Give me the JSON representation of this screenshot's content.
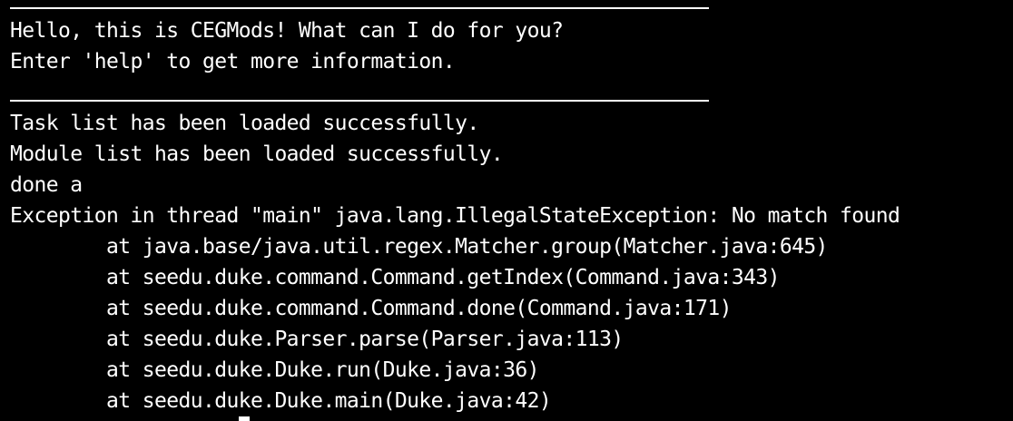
{
  "terminal": {
    "welcome": "Hello, this is CEGMods! What can I do for you?",
    "help_hint": "Enter 'help' to get more information.",
    "task_loaded": "Task list has been loaded successfully.",
    "module_loaded": "Module list has been loaded successfully.",
    "command": "done a",
    "exception": "Exception in thread \"main\" java.lang.IllegalStateException: No match found",
    "stack": [
      "        at java.base/java.util.regex.Matcher.group(Matcher.java:645)",
      "        at seedu.duke.command.Command.getIndex(Command.java:343)",
      "        at seedu.duke.command.Command.done(Command.java:171)",
      "        at seedu.duke.Parser.parse(Parser.java:113)",
      "        at seedu.duke.Duke.run(Duke.java:36)",
      "        at seedu.duke.Duke.main(Duke.java:42)"
    ]
  }
}
